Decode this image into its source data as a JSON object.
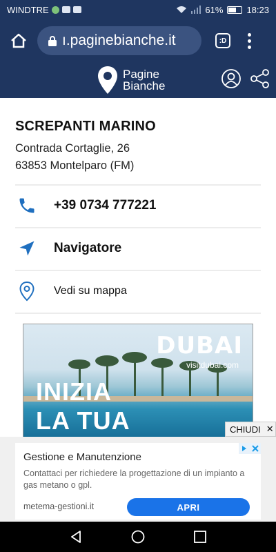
{
  "status_bar": {
    "carrier": "WINDTRE",
    "battery": "61%",
    "battery_level": 0.61,
    "time": "18:23"
  },
  "browser": {
    "url": "ı.paginebianche.it",
    "tabs_label": ":D"
  },
  "site": {
    "logo_line1": "Pagine",
    "logo_line2": "Bianche"
  },
  "business": {
    "name": "SCREPANTI MARINO",
    "address_line1": "Contrada Cortaglie, 26",
    "address_line2": "63853 Montelparo (FM)",
    "phone": "+39 0734 777221",
    "navigator": "Navigatore",
    "map": "Vedi su mappa"
  },
  "banner_ad": {
    "brand": "DUBAI",
    "brand_url": "visitdubai.com",
    "headline_line1": "INIZIA",
    "headline_line2": "LA TUA",
    "close_label": "CHIUDI"
  },
  "bottom_ad": {
    "title": "Gestione e Manutenzione",
    "description": "Contattaci per richiedere la progettazione di un impianto a gas metano o gpl.",
    "domain": "metema-gestioni.it",
    "cta": "APRI"
  },
  "colors": {
    "header": "#1f3660",
    "url_bar": "#3b5380",
    "accent_blue": "#1f6fbf",
    "cta_blue": "#1a73e8"
  }
}
